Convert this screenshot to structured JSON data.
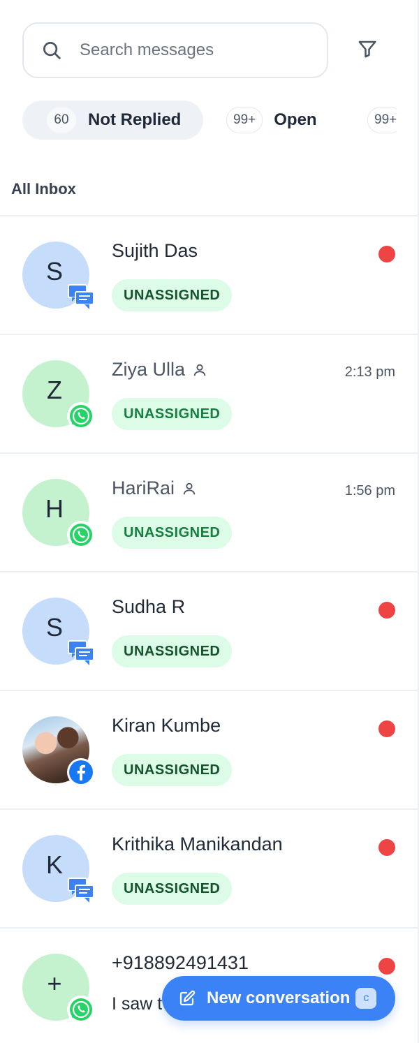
{
  "search": {
    "placeholder": "Search messages"
  },
  "tabs": [
    {
      "count": "60",
      "label": "Not Replied"
    },
    {
      "count": "99+",
      "label": "Open"
    },
    {
      "count": "99+",
      "label": ""
    }
  ],
  "section_title": "All Inbox",
  "conversations": [
    {
      "initial": "S",
      "name": "Sujith Das",
      "tag": "UNASSIGNED",
      "channel": "chat-icon"
    },
    {
      "initial": "Z",
      "name": "Ziya Ulla",
      "tag": "UNASSIGNED",
      "time": "2:13 pm",
      "channel": "whatsapp-icon"
    },
    {
      "initial": "H",
      "name": "HariRai",
      "tag": "UNASSIGNED",
      "time": "1:56 pm",
      "channel": "whatsapp-icon"
    },
    {
      "initial": "S",
      "name": "Sudha R",
      "tag": "UNASSIGNED",
      "channel": "chat-icon"
    },
    {
      "initial": "",
      "name": "Kiran Kumbe",
      "tag": "UNASSIGNED",
      "channel": "facebook-icon"
    },
    {
      "initial": "K",
      "name": "Krithika Manikandan",
      "tag": "UNASSIGNED",
      "channel": "chat-icon"
    },
    {
      "initial": "+",
      "name": "+918892491431",
      "preview": "I saw t",
      "channel": "whatsapp-icon"
    }
  ],
  "fab": {
    "label": "New conversation",
    "shortcut": "c"
  },
  "colors": {
    "accent": "#3b82f6",
    "unread": "#ef4444",
    "tag_bg": "#dcfce7",
    "tag_text": "#15803d"
  }
}
